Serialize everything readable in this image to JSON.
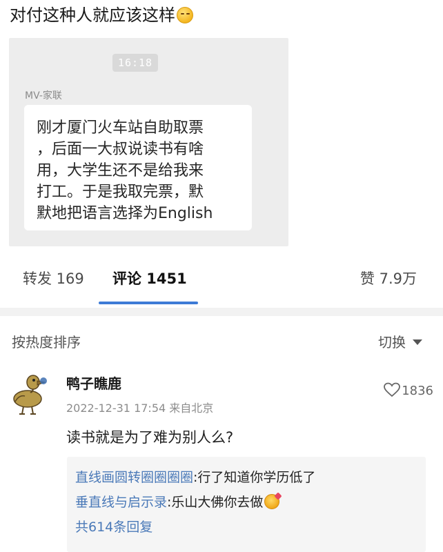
{
  "post": {
    "title": "对付这种人就应该这样",
    "emoji": "grimacing-face-emoji"
  },
  "screenshot": {
    "time": "16:18",
    "sender": "MV-家联",
    "message_lines": [
      "刚才厦门火车站自助取票",
      "，后面一大叔说读书有啥",
      "用，大学生还不是给我来",
      "打工。于是我取完票，默",
      "默地把语言选择为English"
    ]
  },
  "tabs": {
    "forward": "转发 169",
    "comments": "评论 1451",
    "likes": "赞 7.9万",
    "active": "comments",
    "accent_color": "#3d7bd6"
  },
  "sort": {
    "label": "按热度排序",
    "switch_label": "切换"
  },
  "comment": {
    "username": "鸭子瞧鹿",
    "meta": "2022-12-31 17:54 来自北京",
    "likes": "1836",
    "text": "读书就是为了难为别人么?",
    "avatar": "duck-avatar-icon",
    "replies": [
      {
        "user": "直线画圆转圈圈圈圈",
        "text": ":行了知道你学历低了"
      },
      {
        "user": "垂直线与启示录",
        "text": ":乐山大佛你去做"
      }
    ],
    "more_replies": "共614条回复",
    "link_color": "#4a79b8"
  }
}
